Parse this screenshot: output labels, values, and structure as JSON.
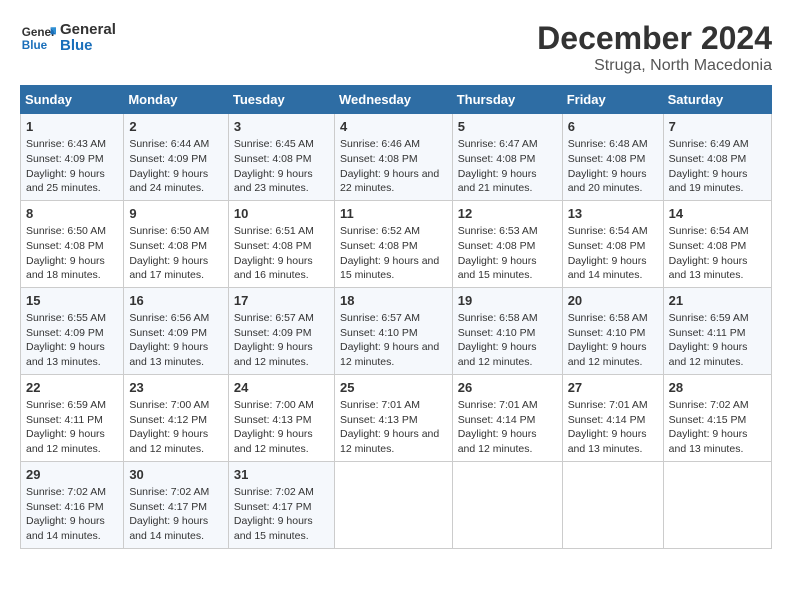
{
  "header": {
    "logo_general": "General",
    "logo_blue": "Blue",
    "main_title": "December 2024",
    "subtitle": "Struga, North Macedonia"
  },
  "days_of_week": [
    "Sunday",
    "Monday",
    "Tuesday",
    "Wednesday",
    "Thursday",
    "Friday",
    "Saturday"
  ],
  "weeks": [
    [
      {
        "day": "1",
        "sunrise": "Sunrise: 6:43 AM",
        "sunset": "Sunset: 4:09 PM",
        "daylight": "Daylight: 9 hours and 25 minutes."
      },
      {
        "day": "2",
        "sunrise": "Sunrise: 6:44 AM",
        "sunset": "Sunset: 4:09 PM",
        "daylight": "Daylight: 9 hours and 24 minutes."
      },
      {
        "day": "3",
        "sunrise": "Sunrise: 6:45 AM",
        "sunset": "Sunset: 4:08 PM",
        "daylight": "Daylight: 9 hours and 23 minutes."
      },
      {
        "day": "4",
        "sunrise": "Sunrise: 6:46 AM",
        "sunset": "Sunset: 4:08 PM",
        "daylight": "Daylight: 9 hours and 22 minutes."
      },
      {
        "day": "5",
        "sunrise": "Sunrise: 6:47 AM",
        "sunset": "Sunset: 4:08 PM",
        "daylight": "Daylight: 9 hours and 21 minutes."
      },
      {
        "day": "6",
        "sunrise": "Sunrise: 6:48 AM",
        "sunset": "Sunset: 4:08 PM",
        "daylight": "Daylight: 9 hours and 20 minutes."
      },
      {
        "day": "7",
        "sunrise": "Sunrise: 6:49 AM",
        "sunset": "Sunset: 4:08 PM",
        "daylight": "Daylight: 9 hours and 19 minutes."
      }
    ],
    [
      {
        "day": "8",
        "sunrise": "Sunrise: 6:50 AM",
        "sunset": "Sunset: 4:08 PM",
        "daylight": "Daylight: 9 hours and 18 minutes."
      },
      {
        "day": "9",
        "sunrise": "Sunrise: 6:50 AM",
        "sunset": "Sunset: 4:08 PM",
        "daylight": "Daylight: 9 hours and 17 minutes."
      },
      {
        "day": "10",
        "sunrise": "Sunrise: 6:51 AM",
        "sunset": "Sunset: 4:08 PM",
        "daylight": "Daylight: 9 hours and 16 minutes."
      },
      {
        "day": "11",
        "sunrise": "Sunrise: 6:52 AM",
        "sunset": "Sunset: 4:08 PM",
        "daylight": "Daylight: 9 hours and 15 minutes."
      },
      {
        "day": "12",
        "sunrise": "Sunrise: 6:53 AM",
        "sunset": "Sunset: 4:08 PM",
        "daylight": "Daylight: 9 hours and 15 minutes."
      },
      {
        "day": "13",
        "sunrise": "Sunrise: 6:54 AM",
        "sunset": "Sunset: 4:08 PM",
        "daylight": "Daylight: 9 hours and 14 minutes."
      },
      {
        "day": "14",
        "sunrise": "Sunrise: 6:54 AM",
        "sunset": "Sunset: 4:08 PM",
        "daylight": "Daylight: 9 hours and 13 minutes."
      }
    ],
    [
      {
        "day": "15",
        "sunrise": "Sunrise: 6:55 AM",
        "sunset": "Sunset: 4:09 PM",
        "daylight": "Daylight: 9 hours and 13 minutes."
      },
      {
        "day": "16",
        "sunrise": "Sunrise: 6:56 AM",
        "sunset": "Sunset: 4:09 PM",
        "daylight": "Daylight: 9 hours and 13 minutes."
      },
      {
        "day": "17",
        "sunrise": "Sunrise: 6:57 AM",
        "sunset": "Sunset: 4:09 PM",
        "daylight": "Daylight: 9 hours and 12 minutes."
      },
      {
        "day": "18",
        "sunrise": "Sunrise: 6:57 AM",
        "sunset": "Sunset: 4:10 PM",
        "daylight": "Daylight: 9 hours and 12 minutes."
      },
      {
        "day": "19",
        "sunrise": "Sunrise: 6:58 AM",
        "sunset": "Sunset: 4:10 PM",
        "daylight": "Daylight: 9 hours and 12 minutes."
      },
      {
        "day": "20",
        "sunrise": "Sunrise: 6:58 AM",
        "sunset": "Sunset: 4:10 PM",
        "daylight": "Daylight: 9 hours and 12 minutes."
      },
      {
        "day": "21",
        "sunrise": "Sunrise: 6:59 AM",
        "sunset": "Sunset: 4:11 PM",
        "daylight": "Daylight: 9 hours and 12 minutes."
      }
    ],
    [
      {
        "day": "22",
        "sunrise": "Sunrise: 6:59 AM",
        "sunset": "Sunset: 4:11 PM",
        "daylight": "Daylight: 9 hours and 12 minutes."
      },
      {
        "day": "23",
        "sunrise": "Sunrise: 7:00 AM",
        "sunset": "Sunset: 4:12 PM",
        "daylight": "Daylight: 9 hours and 12 minutes."
      },
      {
        "day": "24",
        "sunrise": "Sunrise: 7:00 AM",
        "sunset": "Sunset: 4:13 PM",
        "daylight": "Daylight: 9 hours and 12 minutes."
      },
      {
        "day": "25",
        "sunrise": "Sunrise: 7:01 AM",
        "sunset": "Sunset: 4:13 PM",
        "daylight": "Daylight: 9 hours and 12 minutes."
      },
      {
        "day": "26",
        "sunrise": "Sunrise: 7:01 AM",
        "sunset": "Sunset: 4:14 PM",
        "daylight": "Daylight: 9 hours and 12 minutes."
      },
      {
        "day": "27",
        "sunrise": "Sunrise: 7:01 AM",
        "sunset": "Sunset: 4:14 PM",
        "daylight": "Daylight: 9 hours and 13 minutes."
      },
      {
        "day": "28",
        "sunrise": "Sunrise: 7:02 AM",
        "sunset": "Sunset: 4:15 PM",
        "daylight": "Daylight: 9 hours and 13 minutes."
      }
    ],
    [
      {
        "day": "29",
        "sunrise": "Sunrise: 7:02 AM",
        "sunset": "Sunset: 4:16 PM",
        "daylight": "Daylight: 9 hours and 14 minutes."
      },
      {
        "day": "30",
        "sunrise": "Sunrise: 7:02 AM",
        "sunset": "Sunset: 4:17 PM",
        "daylight": "Daylight: 9 hours and 14 minutes."
      },
      {
        "day": "31",
        "sunrise": "Sunrise: 7:02 AM",
        "sunset": "Sunset: 4:17 PM",
        "daylight": "Daylight: 9 hours and 15 minutes."
      },
      null,
      null,
      null,
      null
    ]
  ]
}
